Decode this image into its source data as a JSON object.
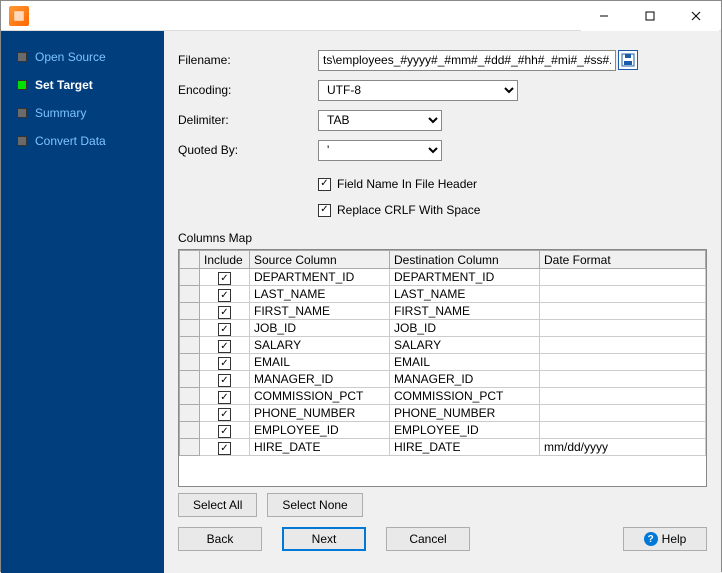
{
  "sidebar": {
    "items": [
      {
        "label": "Open Source"
      },
      {
        "label": "Set Target"
      },
      {
        "label": "Summary"
      },
      {
        "label": "Convert Data"
      }
    ],
    "active_index": 1
  },
  "form": {
    "filename_label": "Filename:",
    "filename_value": "ts\\employees_#yyyy#_#mm#_#dd#_#hh#_#mi#_#ss#.tsv",
    "encoding_label": "Encoding:",
    "encoding_value": "UTF-8",
    "delimiter_label": "Delimiter:",
    "delimiter_value": "TAB",
    "quoted_label": "Quoted By:",
    "quoted_value": "'",
    "field_header_label": "Field Name In File Header",
    "field_header_checked": true,
    "replace_crlf_label": "Replace CRLF With Space",
    "replace_crlf_checked": true
  },
  "columns_map": {
    "title": "Columns Map",
    "headers": {
      "include": "Include",
      "source": "Source Column",
      "destination": "Destination Column",
      "date_format": "Date Format"
    },
    "rows": [
      {
        "include": true,
        "source": "DEPARTMENT_ID",
        "destination": "DEPARTMENT_ID",
        "date_format": ""
      },
      {
        "include": true,
        "source": "LAST_NAME",
        "destination": "LAST_NAME",
        "date_format": ""
      },
      {
        "include": true,
        "source": "FIRST_NAME",
        "destination": "FIRST_NAME",
        "date_format": ""
      },
      {
        "include": true,
        "source": "JOB_ID",
        "destination": "JOB_ID",
        "date_format": ""
      },
      {
        "include": true,
        "source": "SALARY",
        "destination": "SALARY",
        "date_format": ""
      },
      {
        "include": true,
        "source": "EMAIL",
        "destination": "EMAIL",
        "date_format": ""
      },
      {
        "include": true,
        "source": "MANAGER_ID",
        "destination": "MANAGER_ID",
        "date_format": ""
      },
      {
        "include": true,
        "source": "COMMISSION_PCT",
        "destination": "COMMISSION_PCT",
        "date_format": ""
      },
      {
        "include": true,
        "source": "PHONE_NUMBER",
        "destination": "PHONE_NUMBER",
        "date_format": ""
      },
      {
        "include": true,
        "source": "EMPLOYEE_ID",
        "destination": "EMPLOYEE_ID",
        "date_format": ""
      },
      {
        "include": true,
        "source": "HIRE_DATE",
        "destination": "HIRE_DATE",
        "date_format": "mm/dd/yyyy"
      }
    ]
  },
  "buttons": {
    "select_all": "Select All",
    "select_none": "Select None",
    "back": "Back",
    "next": "Next",
    "cancel": "Cancel",
    "help": "Help"
  }
}
